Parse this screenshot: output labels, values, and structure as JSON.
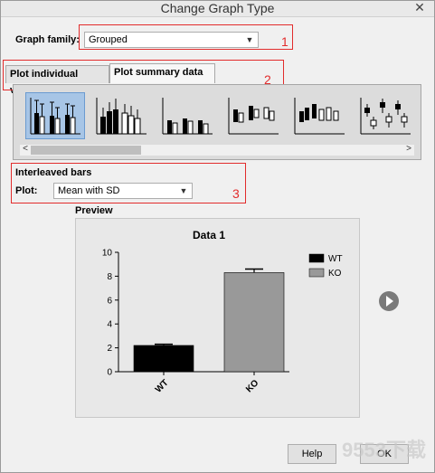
{
  "window": {
    "title": "Change Graph Type",
    "close_glyph": "✕"
  },
  "graph_family": {
    "label": "Graph family:",
    "value": "Grouped"
  },
  "tabs": [
    {
      "label": "Plot individual values",
      "active": false
    },
    {
      "label": "Plot summary data",
      "active": true
    }
  ],
  "thumbnails": [
    {
      "name": "grouped-thumb-1",
      "selected": true
    },
    {
      "name": "grouped-thumb-2",
      "selected": false
    },
    {
      "name": "grouped-thumb-3",
      "selected": false
    },
    {
      "name": "grouped-thumb-4",
      "selected": false
    },
    {
      "name": "grouped-thumb-5",
      "selected": false
    },
    {
      "name": "grouped-thumb-6",
      "selected": false
    }
  ],
  "scrollbar": {
    "left_arrow": "<",
    "right_arrow": ">"
  },
  "interleaved": {
    "heading": "Interleaved bars",
    "plot_label": "Plot:",
    "plot_value": "Mean with SD"
  },
  "annotations": {
    "box1": "1",
    "box2": "2",
    "box3": "3",
    "color": "#e22c2c"
  },
  "preview": {
    "label": "Preview"
  },
  "chart_data": {
    "type": "bar",
    "title": "Data 1",
    "categories": [
      "WT",
      "KO"
    ],
    "series": [
      {
        "name": "WT",
        "values": [
          2.2
        ],
        "error": [
          0.1
        ],
        "color": "#000000"
      },
      {
        "name": "KO",
        "values": [
          8.3
        ],
        "error": [
          0.3
        ],
        "color": "#999999"
      }
    ],
    "ylim": [
      0,
      10
    ],
    "yticks": [
      "0",
      "2",
      "4",
      "6",
      "8",
      "10"
    ],
    "xlabel": "",
    "ylabel": "",
    "legend_position": "top-right",
    "grid": false
  },
  "buttons": {
    "help": "Help",
    "ok": "OK"
  },
  "icons": {
    "play": "play-circle-icon"
  },
  "watermark": "9553下载"
}
